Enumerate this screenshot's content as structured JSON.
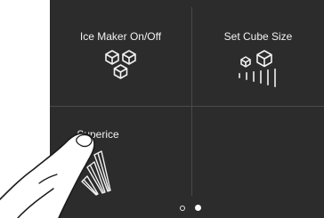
{
  "tiles": {
    "ice_maker": {
      "label": "Ice Maker On/Off",
      "icon": "ice-cubes-icon"
    },
    "cube_size": {
      "label": "Set Cube Size",
      "icon": "cube-size-icon"
    },
    "superice": {
      "label": "Superice",
      "icon": "superice-icon"
    }
  },
  "pagination": {
    "total": 2,
    "current": 2
  },
  "colors": {
    "panel": "#2c2c2c",
    "text": "#f2f2f2",
    "divider": "#4a4a4a"
  }
}
